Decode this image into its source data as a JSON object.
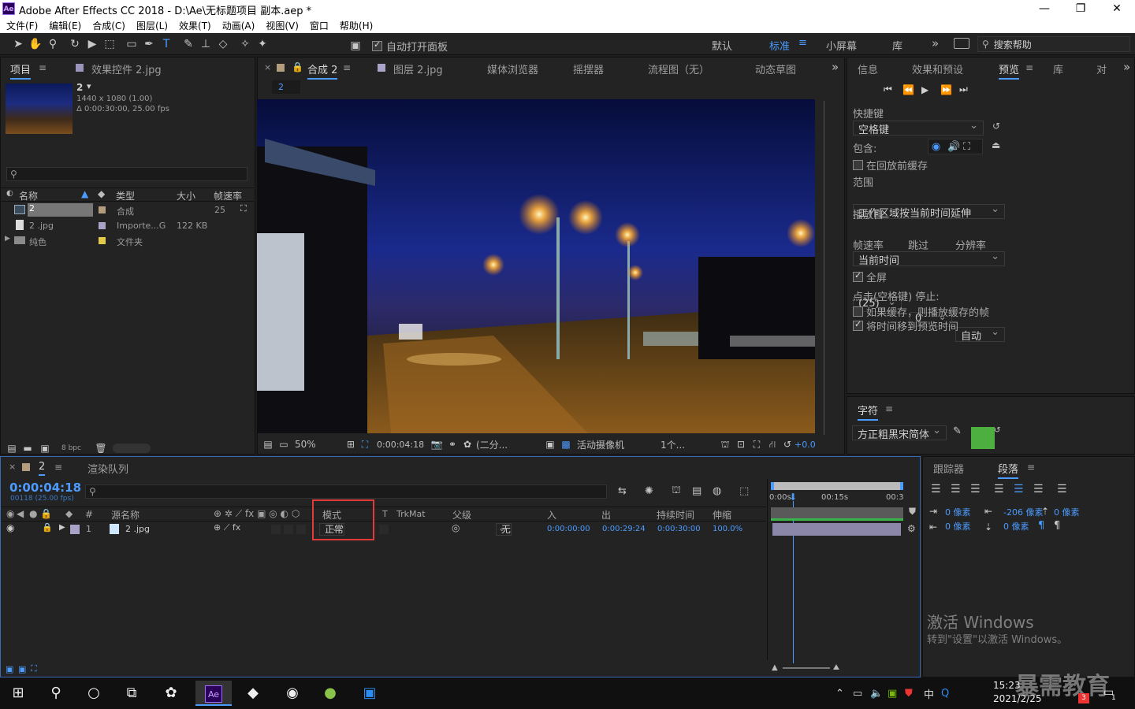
{
  "titlebar": {
    "logo": "Ae",
    "title": "Adobe After Effects CC 2018 - D:\\Ae\\无标题项目 副本.aep *",
    "minimize": "—",
    "maximize": "❐",
    "close": "✕"
  },
  "menubar": {
    "items": [
      "文件(F)",
      "编辑(E)",
      "合成(C)",
      "图层(L)",
      "效果(T)",
      "动画(A)",
      "视图(V)",
      "窗口",
      "帮助(H)"
    ]
  },
  "toolbar": {
    "auto_open_label": "自动打开面板",
    "workspaces": [
      "默认",
      "标准",
      "小屏幕",
      "库"
    ],
    "search_help_placeholder": "搜索帮助",
    "more": "»"
  },
  "project": {
    "tab_project": "项目",
    "tab_effects": "效果控件 2.jpg",
    "item_name": "2",
    "item_info_1": "1440 x 1080 (1.00)",
    "item_info_2": "Δ 0:00:30:00, 25.00 fps",
    "columns": {
      "name": "名称",
      "type": "类型",
      "size": "大小",
      "fps": "帧速率"
    },
    "rows": [
      {
        "name": "2",
        "type": "合成",
        "size": "",
        "fps": "25",
        "color": "#b49d7c"
      },
      {
        "name": "2 .jpg",
        "type": "Importe...G",
        "size": "122 KB",
        "fps": "",
        "color": "#a9a4c7"
      },
      {
        "name": "纯色",
        "type": "文件夹",
        "size": "",
        "fps": "",
        "color": "#e3c94a"
      }
    ],
    "bpc": "8 bpc"
  },
  "comp": {
    "tabs": [
      "合成 2",
      "图层 2.jpg",
      "媒体浏览器",
      "摇摆器",
      "流程图（无）",
      "动态草图"
    ],
    "active_tab": "合成 2",
    "breadcrumb": "2",
    "zoom": "50%",
    "timecode": "0:00:04:18",
    "resolution": "(二分...",
    "camera": "活动摄像机",
    "views": "1个...",
    "exposure": "+0.0"
  },
  "preview": {
    "tabs": [
      "信息",
      "效果和预设",
      "预览",
      "库",
      "对"
    ],
    "active_tab": "预览",
    "shortcut_label": "快捷键",
    "shortcut_value": "空格键",
    "include_label": "包含:",
    "cache_before": "在回放前缓存",
    "range_label": "范围",
    "range_value": "工作区域按当前时间延伸",
    "play_from_label": "播放自",
    "play_from_value": "当前时间",
    "fps_label": "帧速率",
    "skip_label": "跳过",
    "res_label": "分辨率",
    "fps_value": "(25)",
    "skip_value": "0",
    "res_value": "自动",
    "fullscreen": "全屏",
    "stop_label": "点击(空格键) 停止:",
    "if_cached": "如果缓存，则播放缓存的帧",
    "move_time": "将时间移到预览时间"
  },
  "character": {
    "tab": "字符",
    "font": "方正粗黑宋简体",
    "fill_color": "#4caf3f"
  },
  "timeline": {
    "tab_comp": "2",
    "tab_render": "渲染队列",
    "timecode": "0:00:04:18",
    "frame_info": "00118 (25.00 fps)",
    "columns": {
      "num": "#",
      "source": "源名称",
      "mode": "模式",
      "t": "T",
      "trkmat": "TrkMat",
      "parent": "父级",
      "in": "入",
      "out": "出",
      "duration": "持续时间",
      "stretch": "伸缩"
    },
    "layer": {
      "num": "1",
      "name": "2 .jpg",
      "mode": "正常",
      "parent": "无",
      "in": "0:00:00:00",
      "out": "0:00:29:24",
      "duration": "0:00:30:00",
      "stretch": "100.0%"
    },
    "ruler": [
      "0:00s",
      "00:15s",
      "00:3"
    ]
  },
  "paragraph": {
    "tabs": [
      "跟踪器",
      "段落"
    ],
    "active_tab": "段落",
    "indent_left": "0 像素",
    "indent_first": "-206 像素",
    "space_before": "0 像素",
    "indent_right": "0 像素",
    "space_after": "0 像素",
    "activate_title": "激活 Windows",
    "activate_sub": "转到\"设置\"以激活 Windows。"
  },
  "taskbar": {
    "time": "15:23",
    "date": "2021/2/25",
    "ime": "中",
    "watermark": "暴需教育",
    "badge_count": "3",
    "notification_count": "1"
  }
}
